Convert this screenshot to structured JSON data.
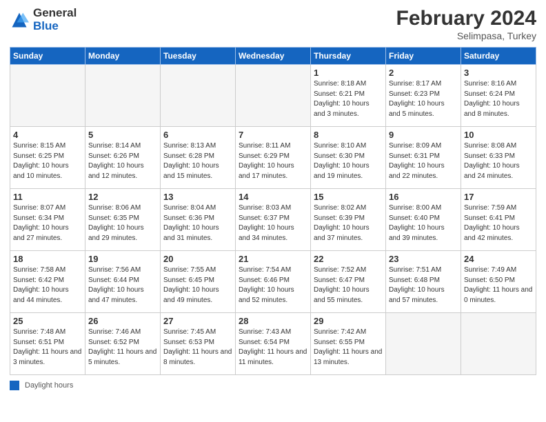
{
  "header": {
    "logo_general": "General",
    "logo_blue": "Blue",
    "title": "February 2024",
    "location": "Selimpasa, Turkey"
  },
  "days_of_week": [
    "Sunday",
    "Monday",
    "Tuesday",
    "Wednesday",
    "Thursday",
    "Friday",
    "Saturday"
  ],
  "weeks": [
    [
      {
        "day": "",
        "info": ""
      },
      {
        "day": "",
        "info": ""
      },
      {
        "day": "",
        "info": ""
      },
      {
        "day": "",
        "info": ""
      },
      {
        "day": "1",
        "info": "Sunrise: 8:18 AM\nSunset: 6:21 PM\nDaylight: 10 hours\nand 3 minutes."
      },
      {
        "day": "2",
        "info": "Sunrise: 8:17 AM\nSunset: 6:23 PM\nDaylight: 10 hours\nand 5 minutes."
      },
      {
        "day": "3",
        "info": "Sunrise: 8:16 AM\nSunset: 6:24 PM\nDaylight: 10 hours\nand 8 minutes."
      }
    ],
    [
      {
        "day": "4",
        "info": "Sunrise: 8:15 AM\nSunset: 6:25 PM\nDaylight: 10 hours\nand 10 minutes."
      },
      {
        "day": "5",
        "info": "Sunrise: 8:14 AM\nSunset: 6:26 PM\nDaylight: 10 hours\nand 12 minutes."
      },
      {
        "day": "6",
        "info": "Sunrise: 8:13 AM\nSunset: 6:28 PM\nDaylight: 10 hours\nand 15 minutes."
      },
      {
        "day": "7",
        "info": "Sunrise: 8:11 AM\nSunset: 6:29 PM\nDaylight: 10 hours\nand 17 minutes."
      },
      {
        "day": "8",
        "info": "Sunrise: 8:10 AM\nSunset: 6:30 PM\nDaylight: 10 hours\nand 19 minutes."
      },
      {
        "day": "9",
        "info": "Sunrise: 8:09 AM\nSunset: 6:31 PM\nDaylight: 10 hours\nand 22 minutes."
      },
      {
        "day": "10",
        "info": "Sunrise: 8:08 AM\nSunset: 6:33 PM\nDaylight: 10 hours\nand 24 minutes."
      }
    ],
    [
      {
        "day": "11",
        "info": "Sunrise: 8:07 AM\nSunset: 6:34 PM\nDaylight: 10 hours\nand 27 minutes."
      },
      {
        "day": "12",
        "info": "Sunrise: 8:06 AM\nSunset: 6:35 PM\nDaylight: 10 hours\nand 29 minutes."
      },
      {
        "day": "13",
        "info": "Sunrise: 8:04 AM\nSunset: 6:36 PM\nDaylight: 10 hours\nand 31 minutes."
      },
      {
        "day": "14",
        "info": "Sunrise: 8:03 AM\nSunset: 6:37 PM\nDaylight: 10 hours\nand 34 minutes."
      },
      {
        "day": "15",
        "info": "Sunrise: 8:02 AM\nSunset: 6:39 PM\nDaylight: 10 hours\nand 37 minutes."
      },
      {
        "day": "16",
        "info": "Sunrise: 8:00 AM\nSunset: 6:40 PM\nDaylight: 10 hours\nand 39 minutes."
      },
      {
        "day": "17",
        "info": "Sunrise: 7:59 AM\nSunset: 6:41 PM\nDaylight: 10 hours\nand 42 minutes."
      }
    ],
    [
      {
        "day": "18",
        "info": "Sunrise: 7:58 AM\nSunset: 6:42 PM\nDaylight: 10 hours\nand 44 minutes."
      },
      {
        "day": "19",
        "info": "Sunrise: 7:56 AM\nSunset: 6:44 PM\nDaylight: 10 hours\nand 47 minutes."
      },
      {
        "day": "20",
        "info": "Sunrise: 7:55 AM\nSunset: 6:45 PM\nDaylight: 10 hours\nand 49 minutes."
      },
      {
        "day": "21",
        "info": "Sunrise: 7:54 AM\nSunset: 6:46 PM\nDaylight: 10 hours\nand 52 minutes."
      },
      {
        "day": "22",
        "info": "Sunrise: 7:52 AM\nSunset: 6:47 PM\nDaylight: 10 hours\nand 55 minutes."
      },
      {
        "day": "23",
        "info": "Sunrise: 7:51 AM\nSunset: 6:48 PM\nDaylight: 10 hours\nand 57 minutes."
      },
      {
        "day": "24",
        "info": "Sunrise: 7:49 AM\nSunset: 6:50 PM\nDaylight: 11 hours\nand 0 minutes."
      }
    ],
    [
      {
        "day": "25",
        "info": "Sunrise: 7:48 AM\nSunset: 6:51 PM\nDaylight: 11 hours\nand 3 minutes."
      },
      {
        "day": "26",
        "info": "Sunrise: 7:46 AM\nSunset: 6:52 PM\nDaylight: 11 hours\nand 5 minutes."
      },
      {
        "day": "27",
        "info": "Sunrise: 7:45 AM\nSunset: 6:53 PM\nDaylight: 11 hours\nand 8 minutes."
      },
      {
        "day": "28",
        "info": "Sunrise: 7:43 AM\nSunset: 6:54 PM\nDaylight: 11 hours\nand 11 minutes."
      },
      {
        "day": "29",
        "info": "Sunrise: 7:42 AM\nSunset: 6:55 PM\nDaylight: 11 hours\nand 13 minutes."
      },
      {
        "day": "",
        "info": ""
      },
      {
        "day": "",
        "info": ""
      }
    ]
  ],
  "legend": {
    "box_label": "Daylight hours"
  }
}
